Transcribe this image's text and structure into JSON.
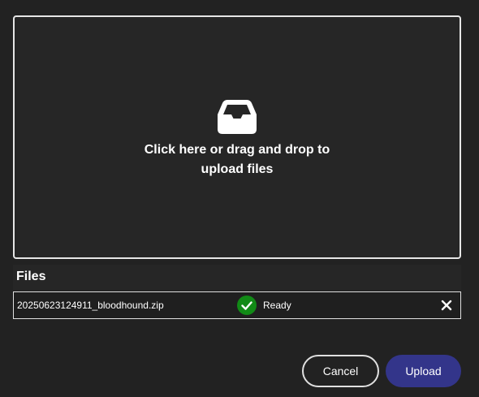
{
  "dropzone": {
    "icon": "inbox-icon",
    "text": "Click here or drag and drop to upload files"
  },
  "files": {
    "header": "Files",
    "items": [
      {
        "name": "20250623124911_bloodhound.zip",
        "status": "Ready",
        "status_icon": "check-circle-icon",
        "status_color": "#118a16",
        "remove_icon": "close-icon"
      }
    ]
  },
  "actions": {
    "cancel_label": "Cancel",
    "upload_label": "Upload",
    "upload_color": "#33358a"
  }
}
